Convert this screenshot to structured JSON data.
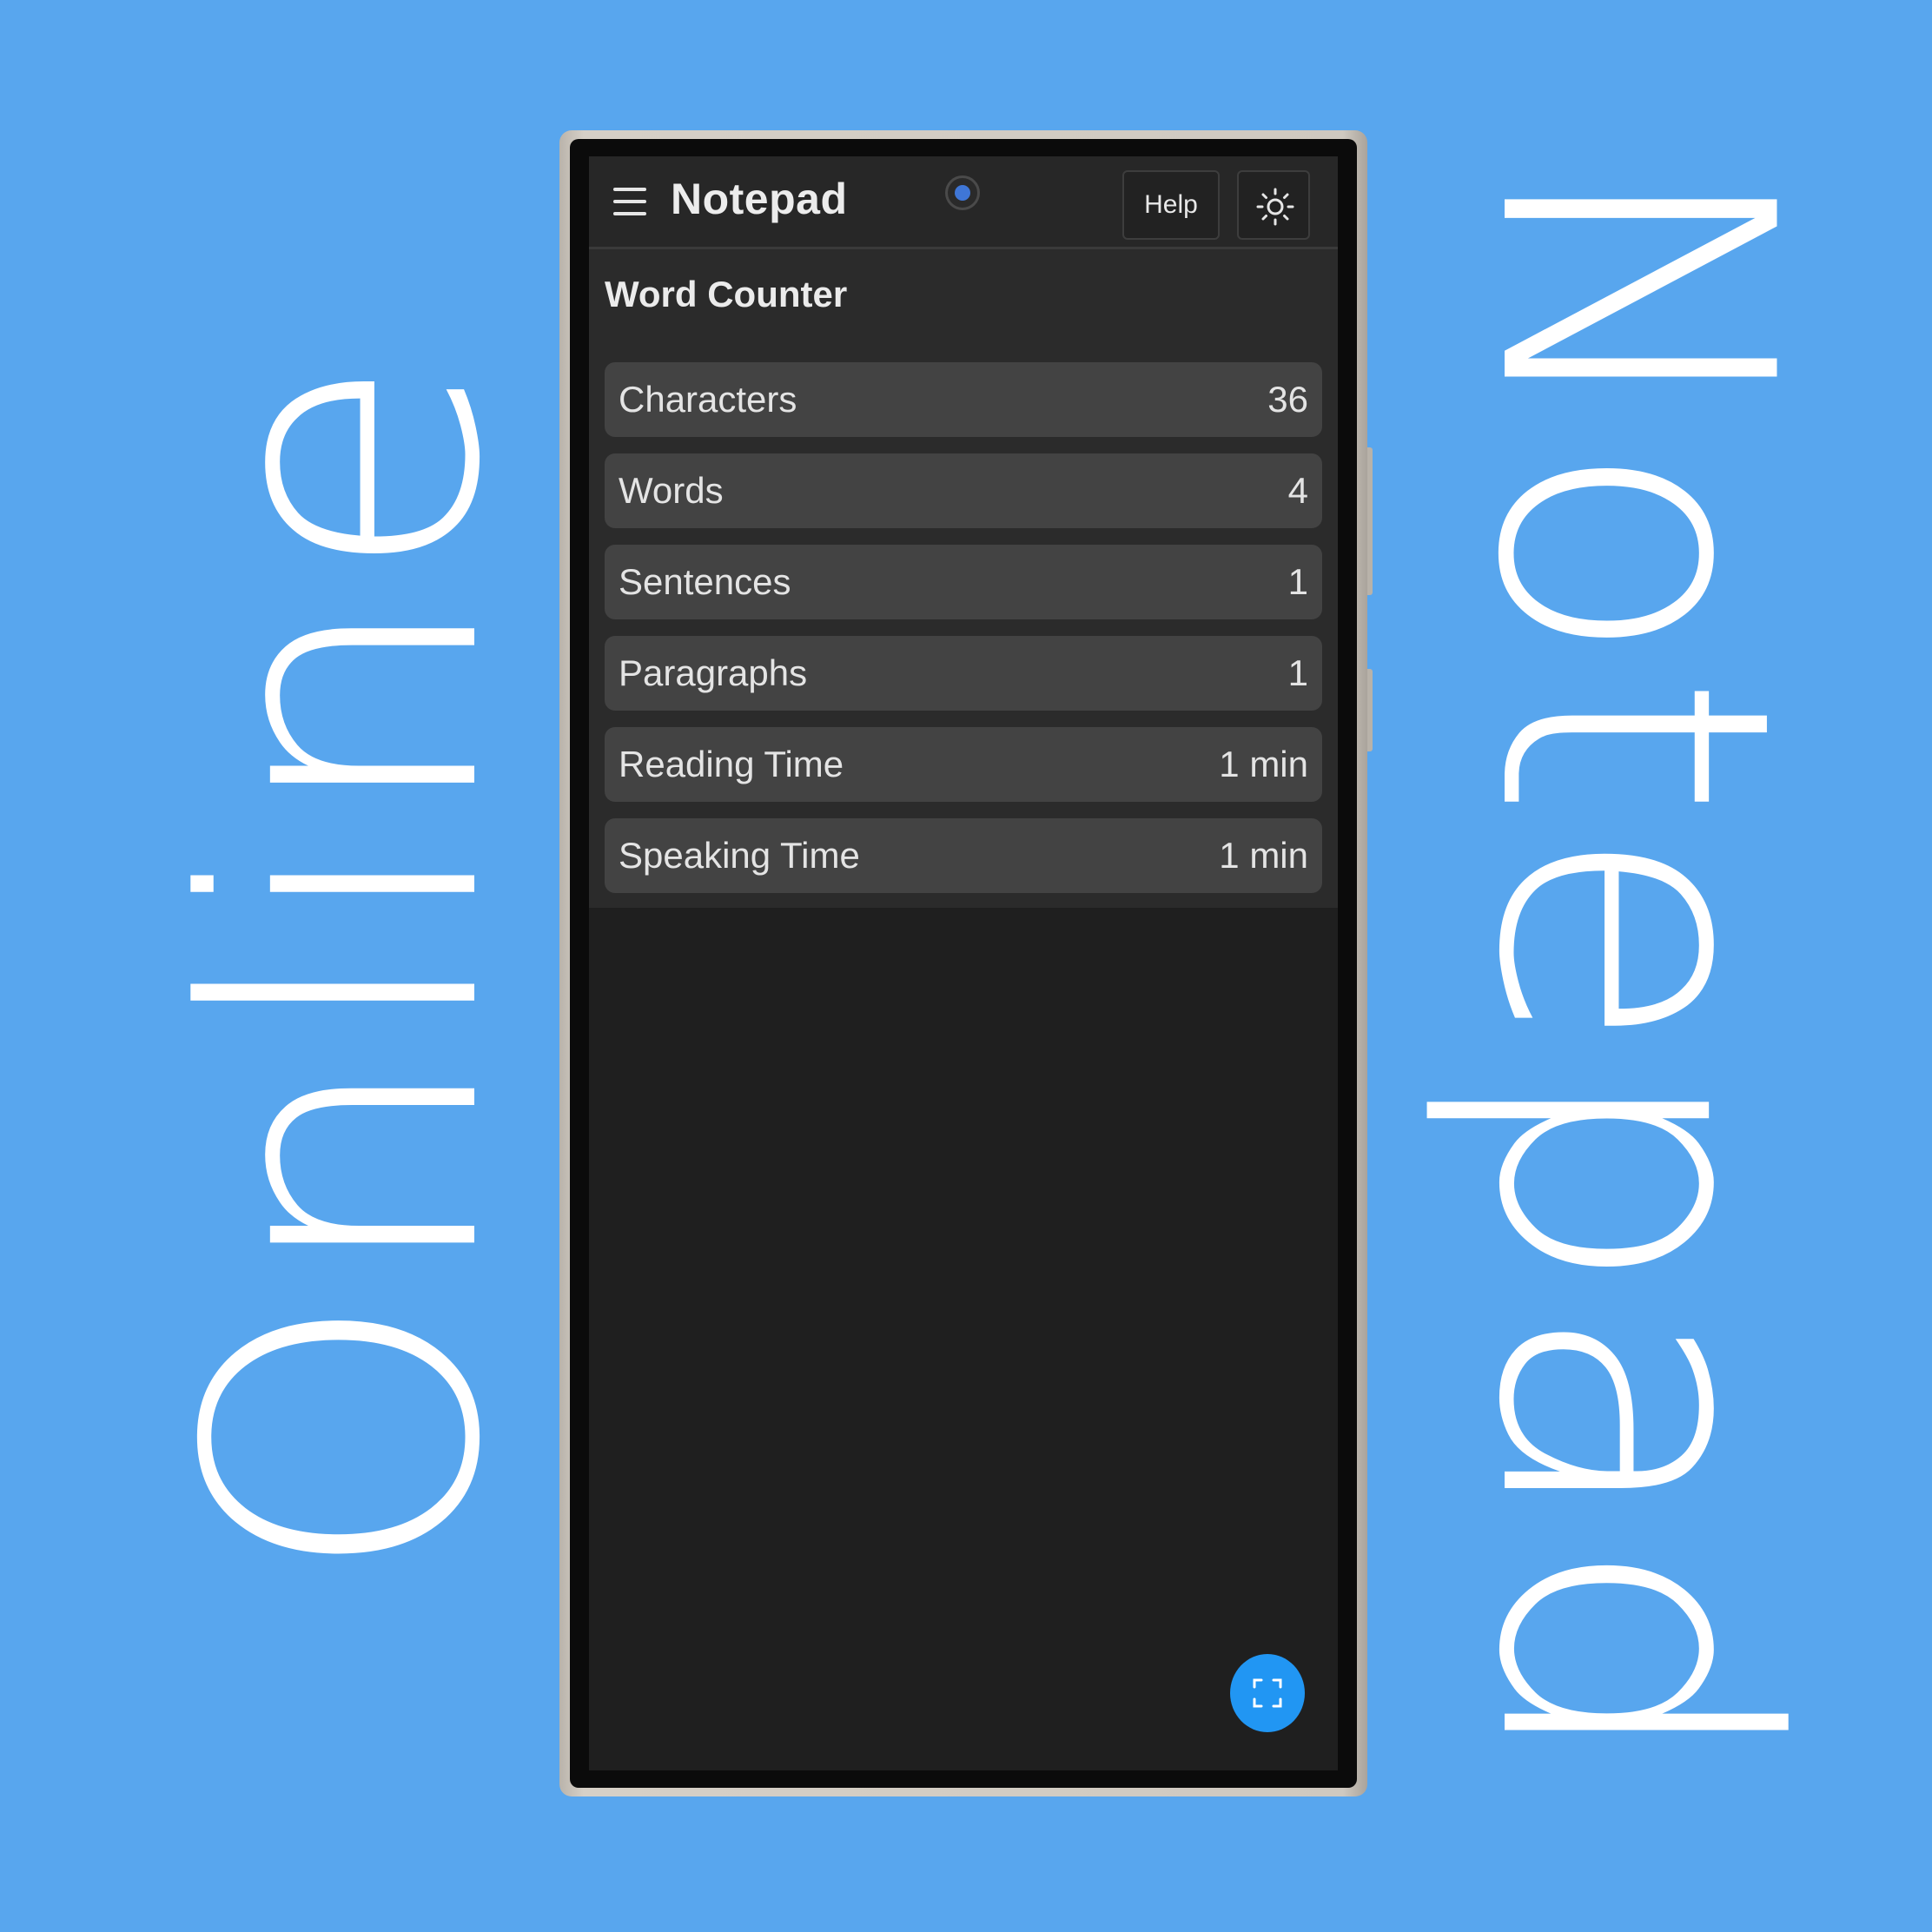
{
  "promo": {
    "left_text": "Online",
    "right_text": "Notepad"
  },
  "app_bar": {
    "title": "Notepad",
    "help_label": "Help",
    "theme_icon": "sun-icon",
    "menu_icon": "hamburger-menu-icon"
  },
  "panel": {
    "title": "Word Counter",
    "stats": [
      {
        "label": "Characters",
        "value": "36"
      },
      {
        "label": "Words",
        "value": "4"
      },
      {
        "label": "Sentences",
        "value": "1"
      },
      {
        "label": "Paragraphs",
        "value": "1"
      },
      {
        "label": "Reading Time",
        "value": "1 min"
      },
      {
        "label": "Speaking Time",
        "value": "1 min"
      }
    ]
  },
  "fab": {
    "icon": "fullscreen-icon"
  },
  "colors": {
    "background": "#58a6ee",
    "screen": "#1f1f1f",
    "row": "#434343",
    "accent": "#2196f3"
  }
}
